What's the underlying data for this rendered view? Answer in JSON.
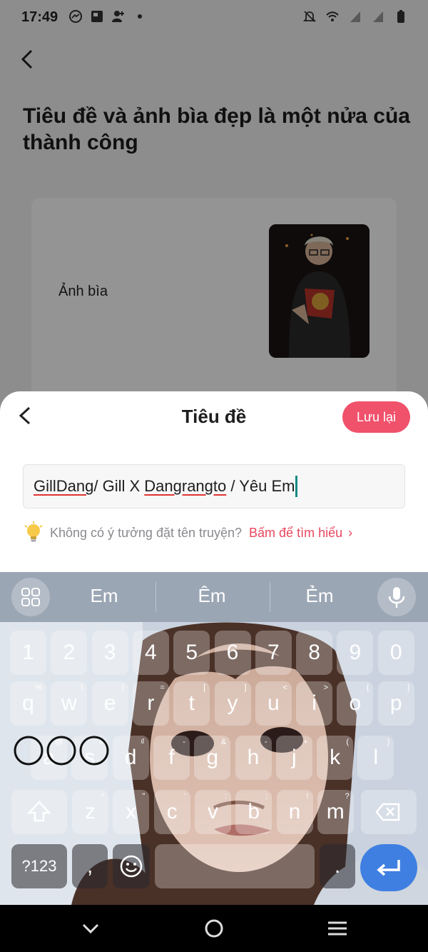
{
  "status_bar": {
    "time": "17:49",
    "left_icons": [
      "messenger-icon",
      "app-notification-icon",
      "person-add-icon",
      "dot-icon"
    ],
    "right_icons": [
      "bell-muted-icon",
      "wifi-icon",
      "signal-icon",
      "signal-icon",
      "battery-icon"
    ]
  },
  "page": {
    "title": "Tiêu đề và ảnh bìa đẹp là một nửa của thành công",
    "cover_label": "Ảnh bìa"
  },
  "sheet": {
    "title": "Tiêu đề",
    "save_label": "Lưu lại",
    "input_segments": [
      "GillDang",
      "/ Gill X ",
      "Dangrangto",
      " / Yêu Em"
    ],
    "hint_text": "Không có ý tưởng đặt tên truyện?",
    "hint_link": "Bấm để tìm hiểu"
  },
  "keyboard": {
    "suggestions": [
      "Em",
      "Êm",
      "Ẻm"
    ],
    "row_numbers": [
      "1",
      "2",
      "3",
      "4",
      "5",
      "6",
      "7",
      "8",
      "9",
      "0"
    ],
    "row1": [
      {
        "k": "q",
        "h": "%"
      },
      {
        "k": "w",
        "h": "\\"
      },
      {
        "k": "e",
        "h": "|"
      },
      {
        "k": "r",
        "h": "="
      },
      {
        "k": "t",
        "h": "["
      },
      {
        "k": "y",
        "h": "]"
      },
      {
        "k": "u",
        "h": "<"
      },
      {
        "k": "i",
        "h": ">"
      },
      {
        "k": "o",
        "h": "{"
      },
      {
        "k": "p",
        "h": "}"
      }
    ],
    "row2": [
      {
        "k": "a",
        "h": "@"
      },
      {
        "k": "s",
        "h": "#"
      },
      {
        "k": "d",
        "h": "₫"
      },
      {
        "k": "f",
        "h": "-"
      },
      {
        "k": "g",
        "h": "&"
      },
      {
        "k": "h",
        "h": "-"
      },
      {
        "k": "j",
        "h": "+"
      },
      {
        "k": "k",
        "h": "("
      },
      {
        "k": "l",
        "h": ")"
      }
    ],
    "row3": [
      {
        "k": "z",
        "h": "*"
      },
      {
        "k": "x",
        "h": "\""
      },
      {
        "k": "c",
        "h": "'"
      },
      {
        "k": "v",
        "h": ":"
      },
      {
        "k": "b",
        "h": ";"
      },
      {
        "k": "n",
        "h": "!"
      },
      {
        "k": "m",
        "h": "?"
      }
    ],
    "symbols_label": "?123",
    "comma_label": ",",
    "period_label": "."
  },
  "colors": {
    "accent": "#f0516b",
    "link": "#e8475e",
    "enter": "#3f7fe2",
    "caret": "#1a8a84"
  }
}
